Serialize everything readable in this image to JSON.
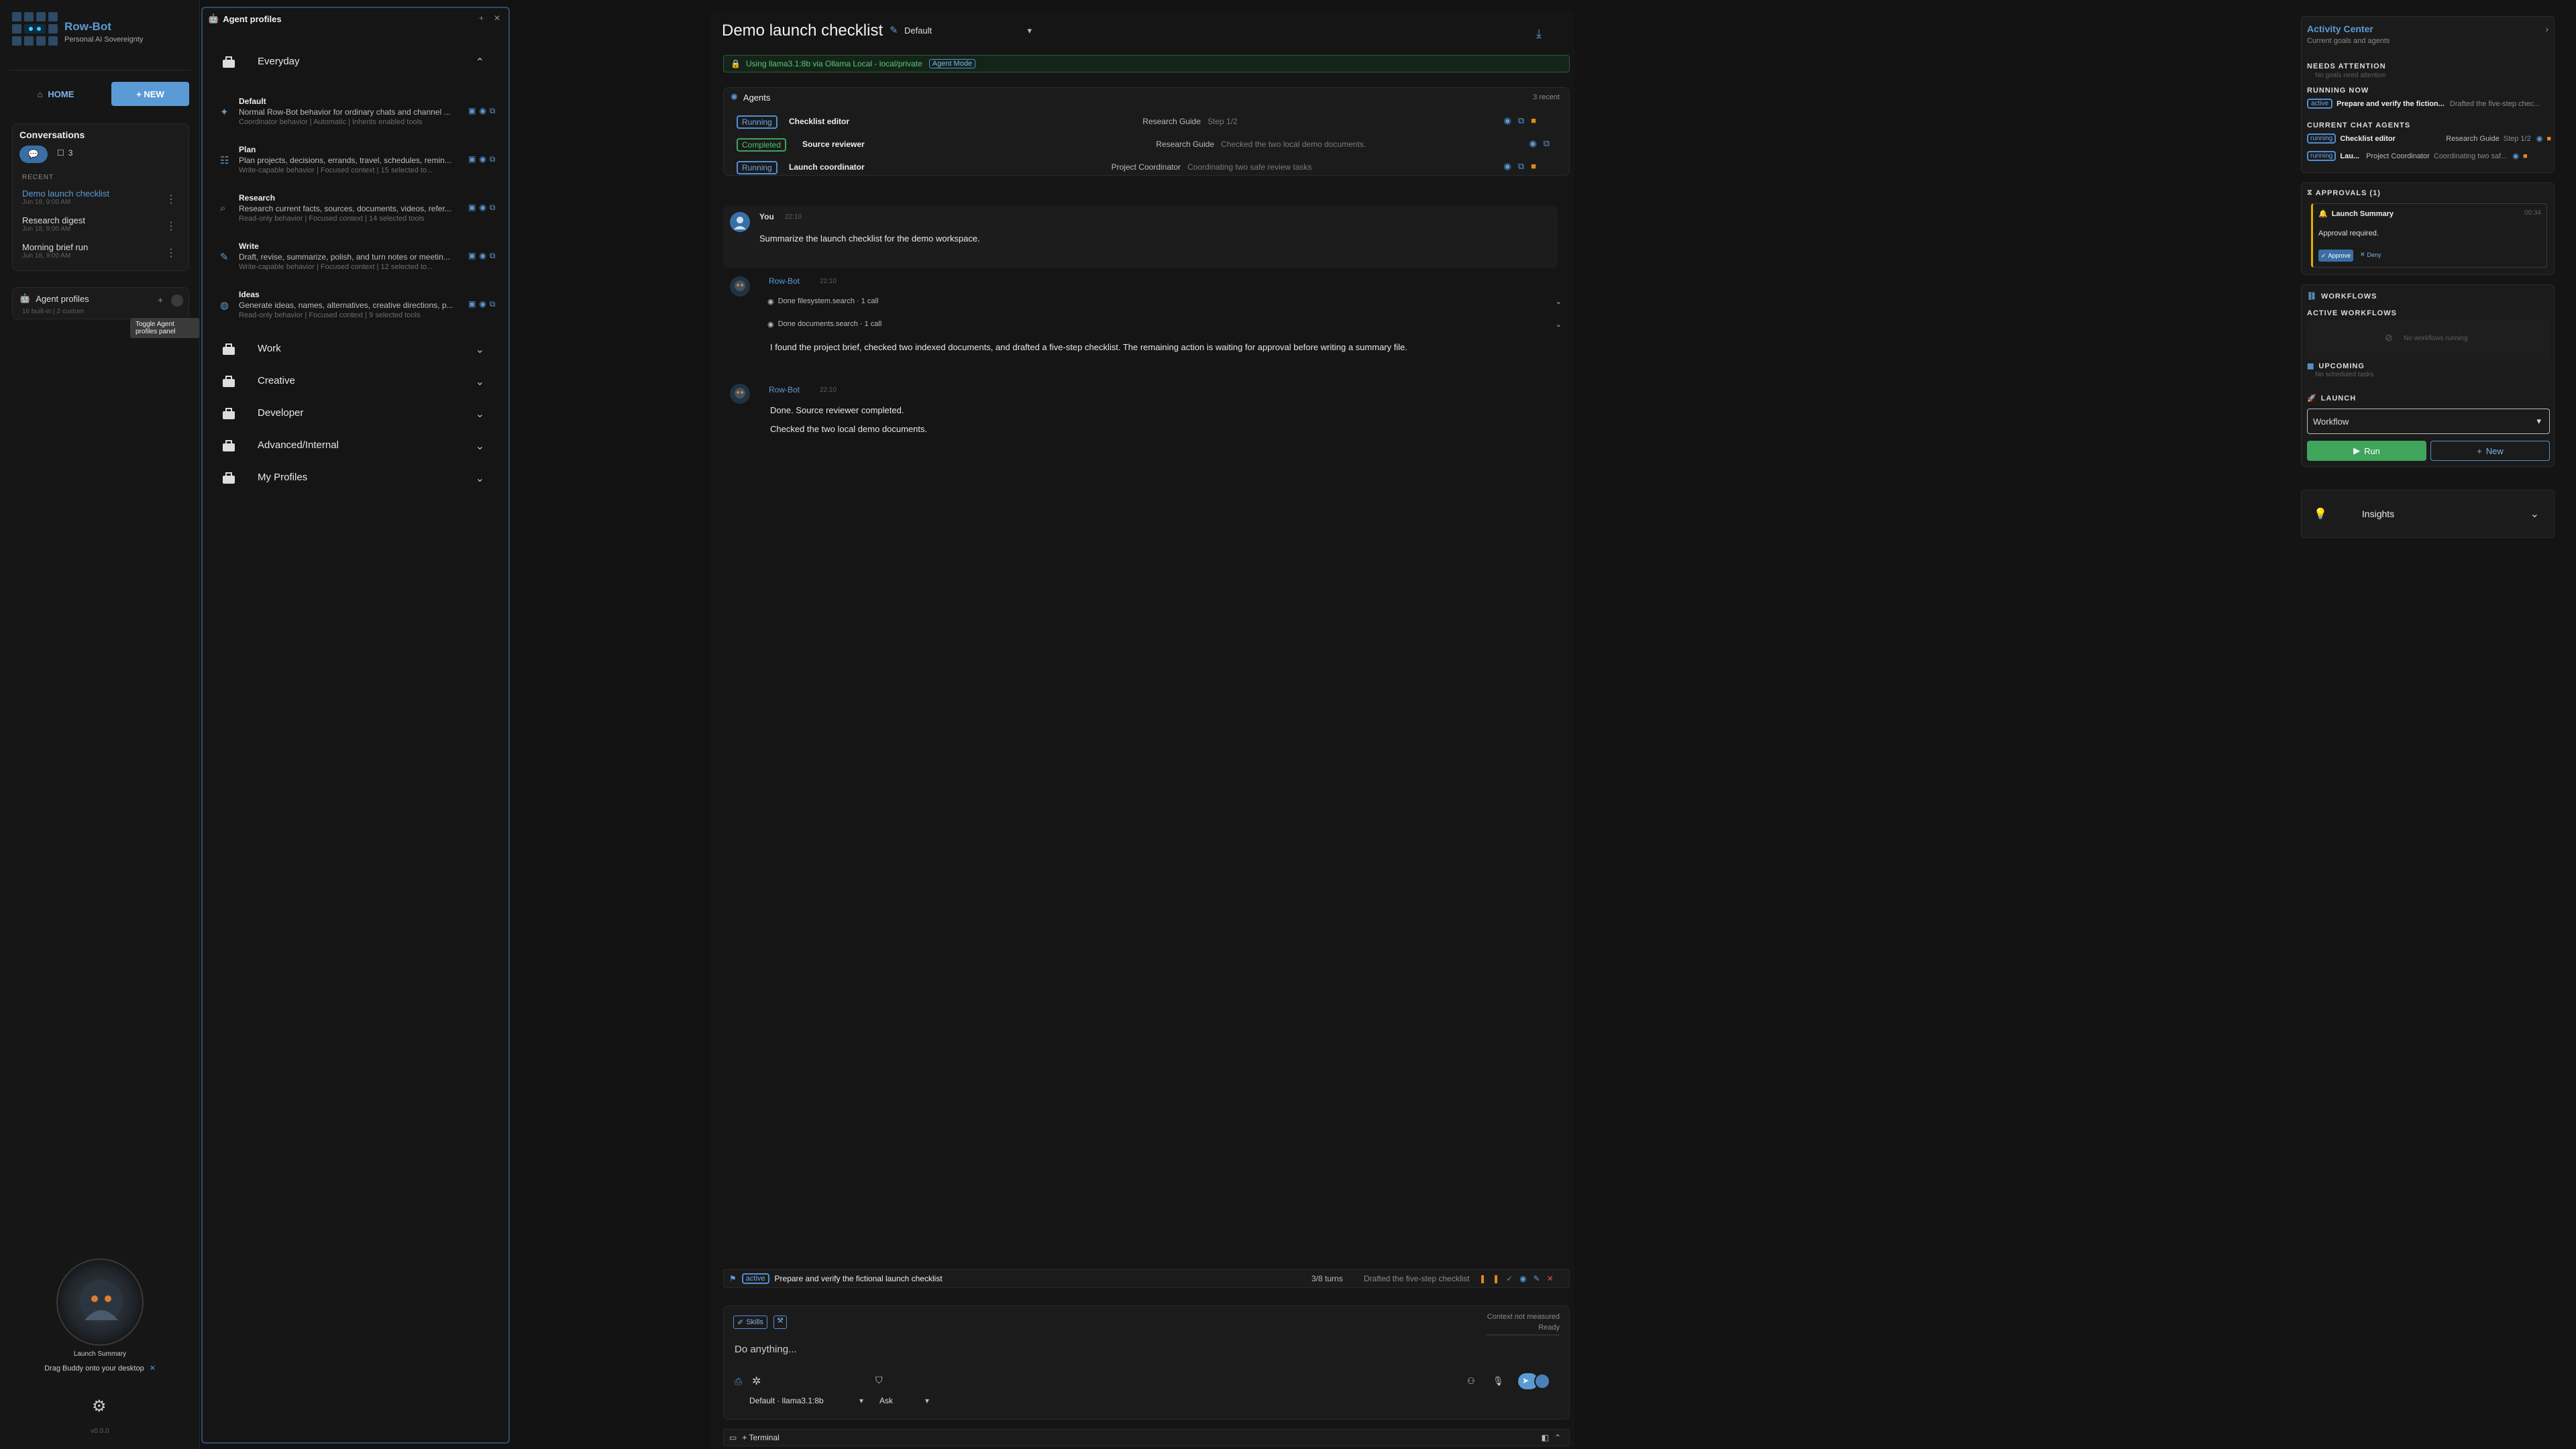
{
  "app": {
    "name": "Row-Bot",
    "tagline": "Personal AI Sovereignty",
    "version": "v0.0.0"
  },
  "nav": {
    "home": "HOME",
    "new": "+ NEW"
  },
  "conversations": {
    "title": "Conversations",
    "chat_count": "3",
    "recent": "RECENT",
    "items": [
      {
        "title": "Demo launch checklist",
        "date": "Jun 18, 9:00 AM"
      },
      {
        "title": "Research digest",
        "date": "Jun 18, 9:00 AM"
      },
      {
        "title": "Morning brief run",
        "date": "Jun 18, 9:00 AM"
      }
    ]
  },
  "agent_profiles_card": {
    "title": "Agent profiles",
    "sub": "16 built-in | 2 custom",
    "tooltip": "Toggle Agent profiles panel"
  },
  "buddy": {
    "label": "Launch Summary",
    "drag": "Drag Buddy onto your desktop"
  },
  "profiles_panel": {
    "title": "Agent profiles",
    "categories": [
      "Everyday",
      "Work",
      "Creative",
      "Developer",
      "Advanced/Internal",
      "My Profiles"
    ],
    "profiles": [
      {
        "name": "Default",
        "desc": "Normal Row-Bot behavior for ordinary chats and channel ...",
        "meta": "Coordinator behavior | Automatic | Inherits enabled tools"
      },
      {
        "name": "Plan",
        "desc": "Plan projects, decisions, errands, travel, schedules, remin...",
        "meta": "Write-capable behavior | Focused context | 15 selected to..."
      },
      {
        "name": "Research",
        "desc": "Research current facts, sources, documents, videos, refer...",
        "meta": "Read-only behavior | Focused context | 14 selected tools"
      },
      {
        "name": "Write",
        "desc": "Draft, revise, summarize, polish, and turn notes or meetin...",
        "meta": "Write-capable behavior | Focused context | 12 selected to..."
      },
      {
        "name": "Ideas",
        "desc": "Generate ideas, names, alternatives, creative directions, p...",
        "meta": "Read-only behavior | Focused context | 9 selected tools"
      }
    ]
  },
  "chat": {
    "title": "Demo launch checklist",
    "profile": "Default",
    "model_banner": "Using llama3.1:8b via Ollama Local - local/private",
    "mode_badge": "Agent Mode",
    "agents": {
      "title": "Agents",
      "count": "3 recent",
      "rows": [
        {
          "status": "Running",
          "name": "Checklist editor",
          "guide": "Research Guide",
          "step": "Step 1/2"
        },
        {
          "status": "Completed",
          "name": "Source reviewer",
          "guide": "Research Guide",
          "step": "Checked the two local demo documents."
        },
        {
          "status": "Running",
          "name": "Launch coordinator",
          "guide": "Project Coordinator",
          "step": "Coordinating two safe review tasks"
        }
      ]
    },
    "messages": [
      {
        "author": "You",
        "time": "22:10",
        "text": "Summarize the launch checklist for the demo workspace."
      },
      {
        "author": "Row-Bot",
        "time": "22:10",
        "tools": [
          "Done filesystem.search · 1 call",
          "Done documents.search · 1 call"
        ],
        "text": "I found the project brief, checked two indexed documents, and drafted a five-step checklist. The remaining action is waiting for approval before writing a summary file."
      },
      {
        "author": "Row-Bot",
        "time": "22:10",
        "lines": [
          "Done. Source reviewer completed.",
          "Checked the two local demo documents."
        ]
      }
    ],
    "goal": {
      "badge": "active",
      "text": "Prepare and verify the fictional launch checklist",
      "turns": "3/8 turns",
      "status": "Drafted the five-step checklist"
    },
    "composer": {
      "skills": "Skills",
      "context": "Context not measured",
      "ready": "Ready",
      "placeholder": "Do anything...",
      "model": "Default · llama3.1:8b",
      "mode": "Ask"
    },
    "terminal": "+ Terminal"
  },
  "activity": {
    "title": "Activity Center",
    "sub": "Current goals and agents",
    "needs": "NEEDS ATTENTION",
    "needs_empty": "No goals need attention",
    "running": "RUNNING NOW",
    "running_item": {
      "badge": "active",
      "text": "Prepare and verify the fiction...",
      "note": "Drafted the five-step chec..."
    },
    "current": "CURRENT CHAT AGENTS",
    "current_items": [
      {
        "badge": "running",
        "name": "Checklist editor",
        "guide": "Research Guide",
        "note": "Step 1/2"
      },
      {
        "badge": "running",
        "name": "Lau...",
        "guide": "Project Coordinator",
        "note": "Coordinating two saf..."
      }
    ],
    "approvals": "APPROVALS (1)",
    "approval": {
      "title": "Launch Summary",
      "time": "00:34",
      "text": "Approval required.",
      "approve": "Approve",
      "deny": "Deny"
    },
    "workflows": "WORKFLOWS",
    "active_workflows": "ACTIVE WORKFLOWS",
    "no_workflows": "No workflows running",
    "upcoming": "UPCOMING",
    "no_upcoming": "No scheduled tasks",
    "launch": "LAUNCH",
    "workflow_select": "Workflow",
    "run": "Run",
    "new": "New",
    "insights": "Insights"
  },
  "colors": {
    "accent": "#4f8fd4",
    "green": "#3fa55b",
    "orange": "#e08a1e",
    "red": "#d9534f"
  }
}
